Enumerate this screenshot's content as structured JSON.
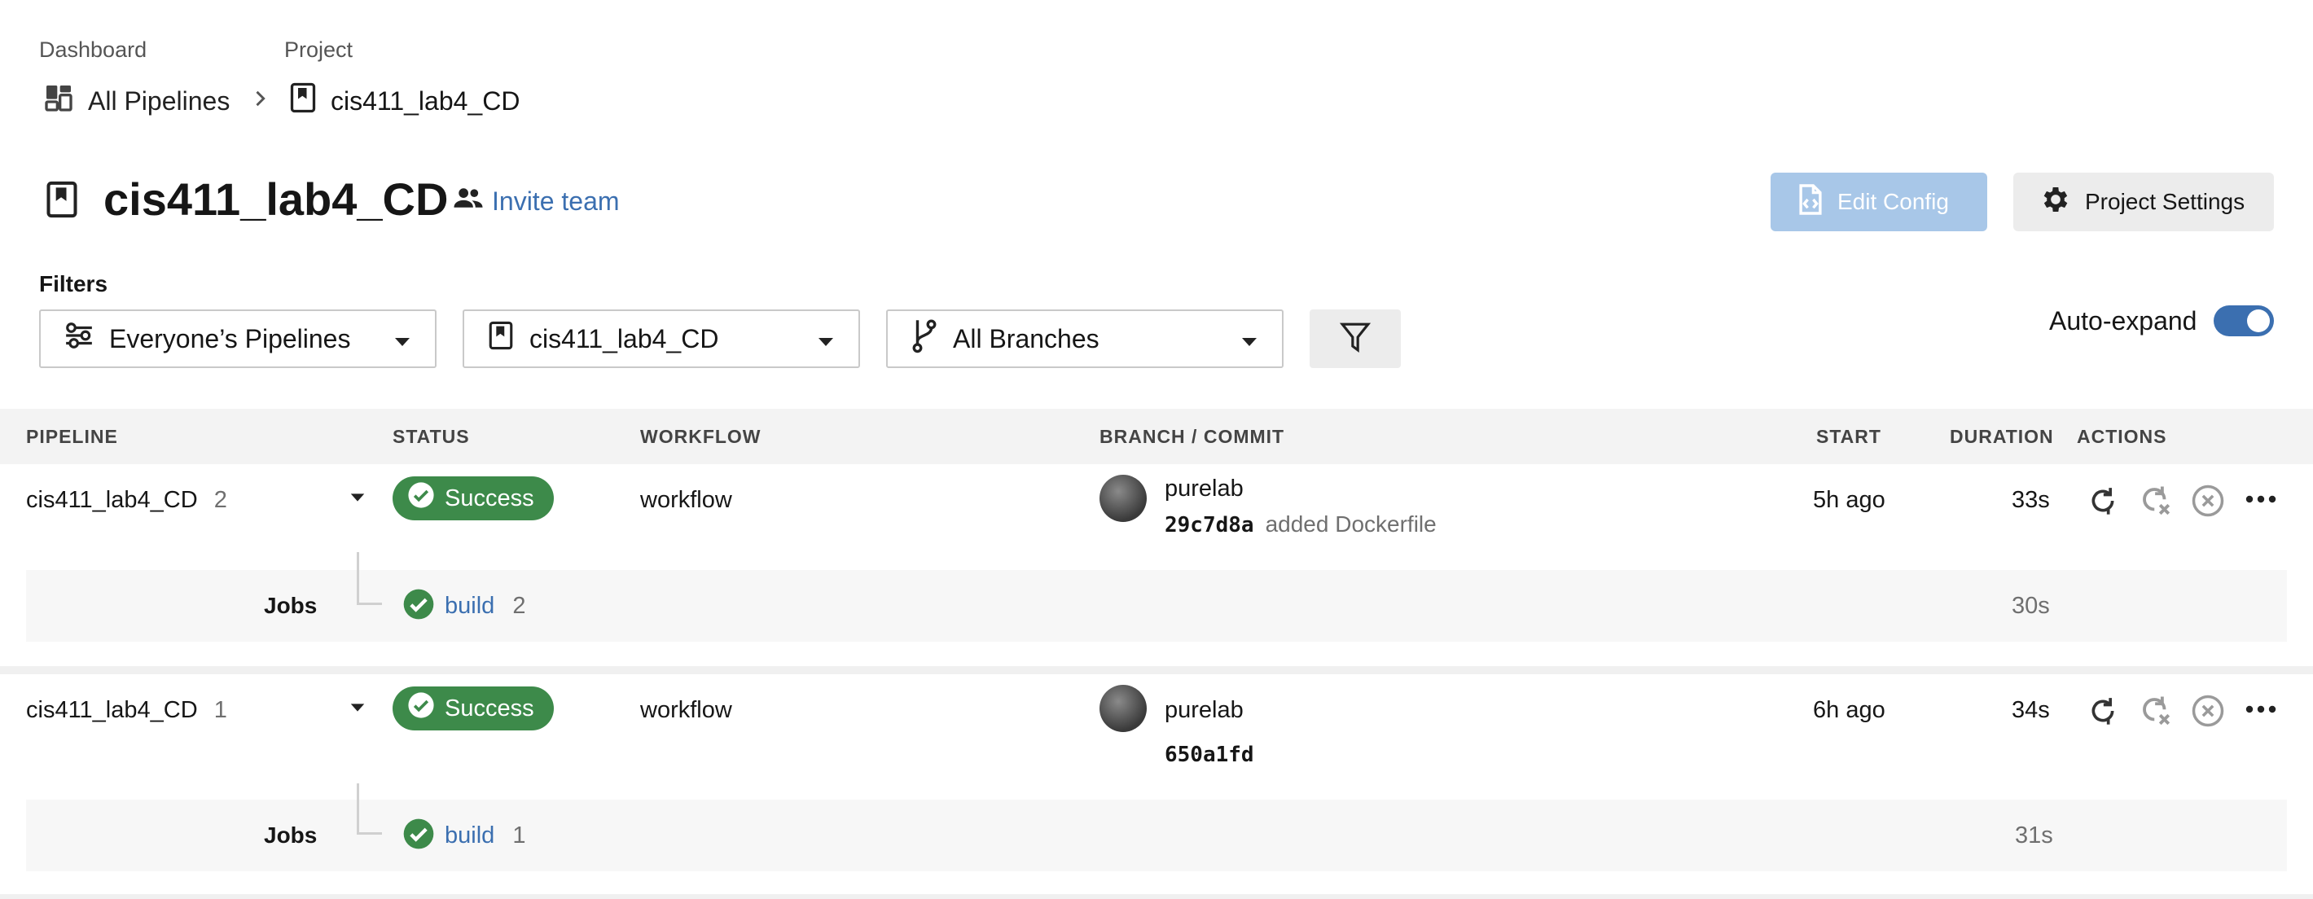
{
  "breadcrumb": {
    "dashboard_label": "Dashboard",
    "dashboard_link": "All Pipelines",
    "project_label": "Project",
    "project_link": "cis411_lab4_CD"
  },
  "header": {
    "title": "cis411_lab4_CD",
    "invite_label": "Invite team",
    "edit_config_label": "Edit Config",
    "project_settings_label": "Project Settings"
  },
  "filters": {
    "label": "Filters",
    "pipelines_select": "Everyone’s Pipelines",
    "project_select": "cis411_lab4_CD",
    "branches_select": "All Branches",
    "auto_expand_label": "Auto-expand",
    "auto_expand_on": true
  },
  "table": {
    "columns": [
      "PIPELINE",
      "STATUS",
      "WORKFLOW",
      "BRANCH / COMMIT",
      "START",
      "DURATION",
      "ACTIONS"
    ],
    "rows": [
      {
        "pipeline": "cis411_lab4_CD",
        "number": "2",
        "status": "Success",
        "workflow": "workflow",
        "branch": "purelab",
        "commit": "29c7d8a",
        "message": "added Dockerfile",
        "start": "5h ago",
        "duration": "33s",
        "jobs_label": "Jobs",
        "job_name": "build",
        "job_number": "2",
        "job_duration": "30s"
      },
      {
        "pipeline": "cis411_lab4_CD",
        "number": "1",
        "status": "Success",
        "workflow": "workflow",
        "branch": "purelab",
        "commit": "650a1fd",
        "message": "",
        "start": "6h ago",
        "duration": "34s",
        "jobs_label": "Jobs",
        "job_name": "build",
        "job_number": "1",
        "job_duration": "31s"
      }
    ]
  },
  "colors": {
    "success": "#3d8a4a",
    "link": "#3b6fb0",
    "edit_button": "#a8c7e8"
  }
}
